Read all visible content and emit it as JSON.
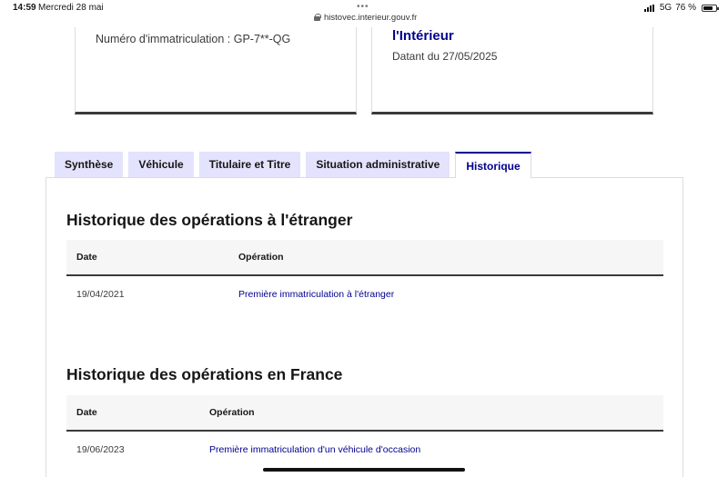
{
  "status_bar": {
    "time": "14:59",
    "date": "Mercredi 28 mai",
    "url": "histovec.interieur.gouv.fr",
    "network": "5G",
    "battery": "76 %",
    "battery_level": 0.76
  },
  "cards": {
    "registration": "Numéro d'immatriculation : GP-7**-QG",
    "ministry_title": "l'Intérieur",
    "dated": "Datant du 27/05/2025"
  },
  "tabs": [
    {
      "label": "Synthèse",
      "active": false
    },
    {
      "label": "Véhicule",
      "active": false
    },
    {
      "label": "Titulaire et Titre",
      "active": false
    },
    {
      "label": "Situation administrative",
      "active": false
    },
    {
      "label": "Historique",
      "active": true
    }
  ],
  "foreign_history": {
    "title": "Historique des opérations à l'étranger",
    "col_date": "Date",
    "col_operation": "Opération",
    "rows": [
      {
        "date": "19/04/2021",
        "operation": "Première immatriculation à l'étranger"
      }
    ]
  },
  "france_history": {
    "title": "Historique des opérations en France",
    "col_date": "Date",
    "col_operation": "Opération",
    "rows": [
      {
        "date": "19/06/2023",
        "operation": "Première immatriculation d'un véhicule d'occasion"
      }
    ]
  }
}
